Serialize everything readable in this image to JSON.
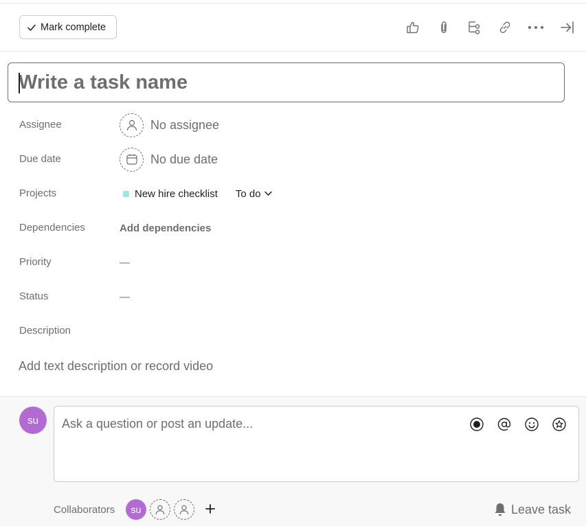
{
  "toolbar": {
    "mark_complete_label": "Mark complete",
    "icons": [
      "like-icon",
      "attachment-icon",
      "subtask-icon",
      "link-icon",
      "more-icon",
      "close-panel-icon"
    ]
  },
  "task": {
    "name_placeholder": "Write a task name"
  },
  "fields": {
    "assignee": {
      "label": "Assignee",
      "value": "No assignee",
      "icon": "person-icon"
    },
    "due_date": {
      "label": "Due date",
      "value": "No due date",
      "icon": "calendar-icon"
    },
    "projects": {
      "label": "Projects",
      "project_name": "New hire checklist",
      "project_color": "#9ee7e3",
      "section": "To do"
    },
    "dependencies": {
      "label": "Dependencies",
      "action": "Add dependencies"
    },
    "priority": {
      "label": "Priority",
      "value": "—"
    },
    "status": {
      "label": "Status",
      "value": "—"
    },
    "description": {
      "label": "Description",
      "placeholder": "Add text description or record video"
    }
  },
  "comments": {
    "avatar_initials": "su",
    "avatar_color": "#b36bd4",
    "placeholder": "Ask a question or post an update...",
    "icons": [
      "record-video-icon",
      "mention-icon",
      "emoji-icon",
      "star-icon"
    ]
  },
  "collaborators": {
    "label": "Collaborators",
    "members": [
      {
        "initials": "su"
      }
    ],
    "leave_label": "Leave task"
  }
}
